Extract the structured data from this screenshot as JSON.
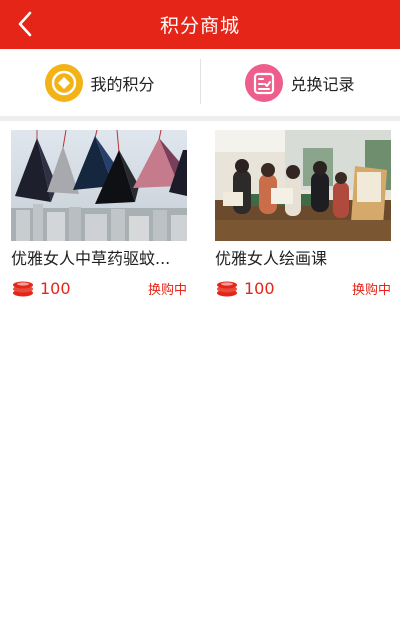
{
  "header": {
    "title": "积分商城",
    "back_icon": "chevron-left-icon",
    "background": "#e42517"
  },
  "quick_links": [
    {
      "label": "我的积分",
      "icon": "coin-diamond-icon",
      "color": "#f3b317"
    },
    {
      "label": "兑换记录",
      "icon": "checklist-icon",
      "color": "#ee5d8c"
    }
  ],
  "products": [
    {
      "title": "优雅女人中草药驱蚊...",
      "points": "100",
      "status": "换购中",
      "image": "sachet-pouches-photo"
    },
    {
      "title": "优雅女人绘画课",
      "points": "100",
      "status": "换购中",
      "image": "painting-class-photo"
    }
  ],
  "colors": {
    "accent": "#e42517"
  }
}
